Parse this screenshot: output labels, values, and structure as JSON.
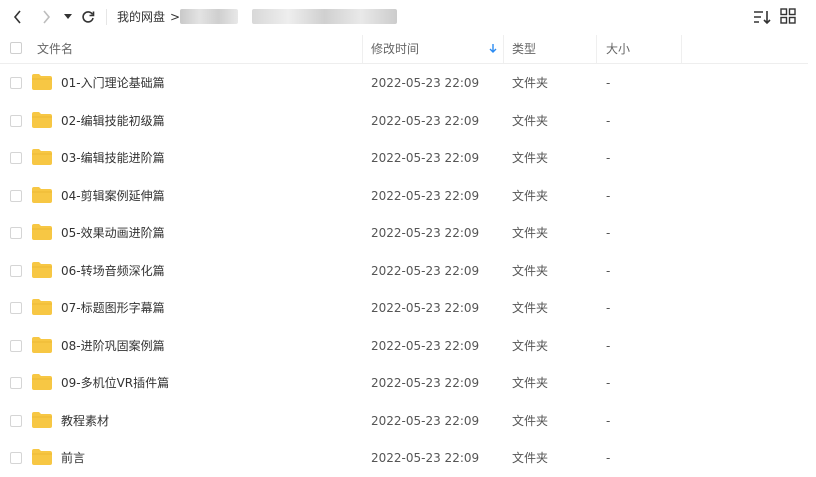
{
  "toolbar": {
    "breadcrumb_root": "我的网盘",
    "breadcrumb_separator": ">"
  },
  "columns": {
    "name": "文件名",
    "modified": "修改时间",
    "type": "类型",
    "size": "大小",
    "sort_indicator": "descending"
  },
  "colors": {
    "folder": "#F7C744",
    "accent": "#2B8BF2"
  },
  "files": [
    {
      "name": "01-入门理论基础篇",
      "modified": "2022-05-23 22:09",
      "type": "文件夹",
      "size": "-"
    },
    {
      "name": "02-编辑技能初级篇",
      "modified": "2022-05-23 22:09",
      "type": "文件夹",
      "size": "-"
    },
    {
      "name": "03-编辑技能进阶篇",
      "modified": "2022-05-23 22:09",
      "type": "文件夹",
      "size": "-"
    },
    {
      "name": "04-剪辑案例延伸篇",
      "modified": "2022-05-23 22:09",
      "type": "文件夹",
      "size": "-"
    },
    {
      "name": "05-效果动画进阶篇",
      "modified": "2022-05-23 22:09",
      "type": "文件夹",
      "size": "-"
    },
    {
      "name": "06-转场音频深化篇",
      "modified": "2022-05-23 22:09",
      "type": "文件夹",
      "size": "-"
    },
    {
      "name": "07-标题图形字幕篇",
      "modified": "2022-05-23 22:09",
      "type": "文件夹",
      "size": "-"
    },
    {
      "name": "08-进阶巩固案例篇",
      "modified": "2022-05-23 22:09",
      "type": "文件夹",
      "size": "-"
    },
    {
      "name": "09-多机位VR插件篇",
      "modified": "2022-05-23 22:09",
      "type": "文件夹",
      "size": "-"
    },
    {
      "name": "教程素材",
      "modified": "2022-05-23 22:09",
      "type": "文件夹",
      "size": "-"
    },
    {
      "name": "前言",
      "modified": "2022-05-23 22:09",
      "type": "文件夹",
      "size": "-"
    }
  ]
}
